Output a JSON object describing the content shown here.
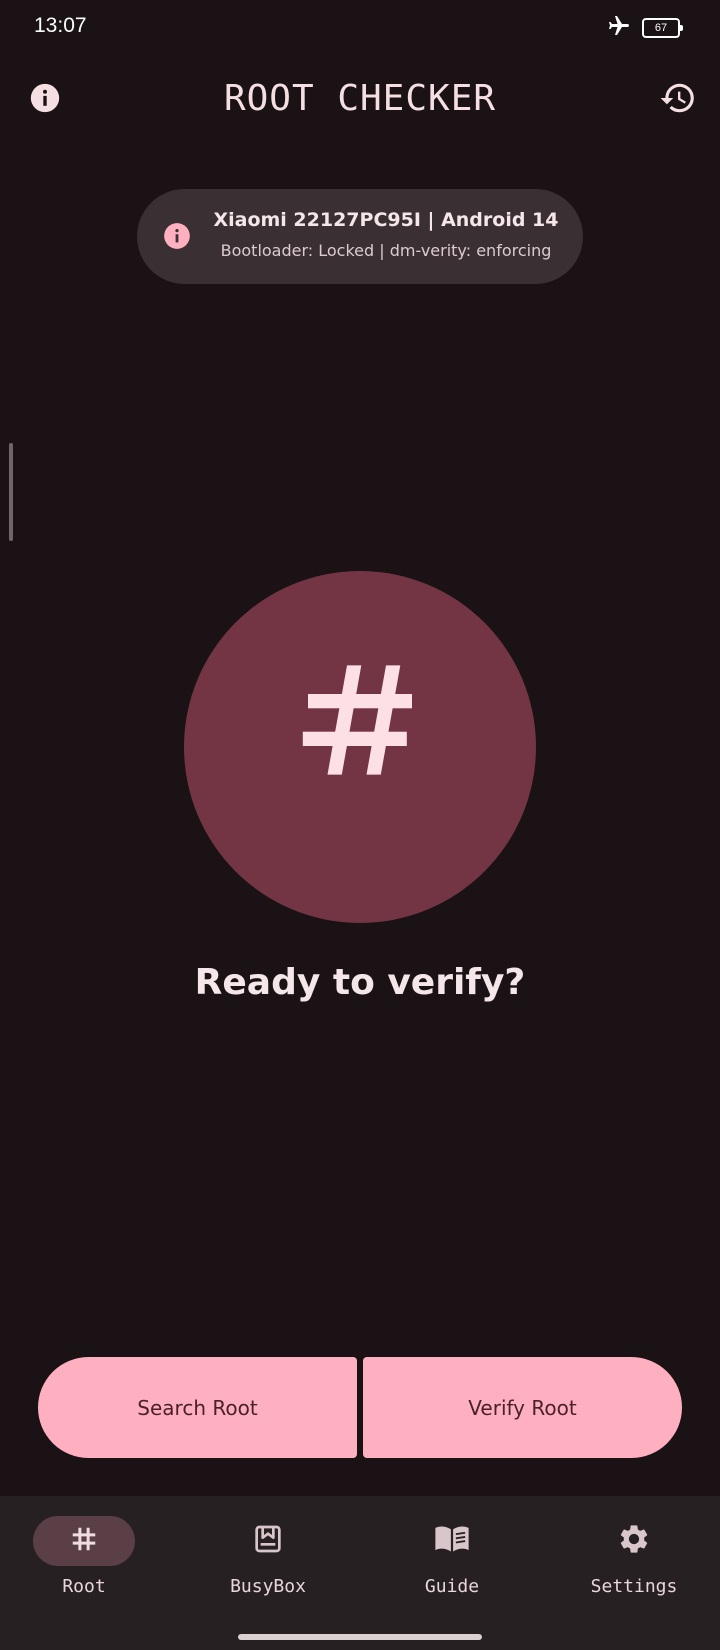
{
  "status_bar": {
    "time": "13:07",
    "battery_level": "67",
    "icons": [
      "airplane-icon",
      "battery-icon"
    ]
  },
  "app_bar": {
    "title": "ROOT CHECKER",
    "left_icon": "info-icon",
    "right_icon": "history-icon"
  },
  "device_info": {
    "model": "Xiaomi 22127PC95I | Android 14",
    "status": "Bootloader: Locked | dm-verity: enforcing",
    "icon": "info-icon"
  },
  "main": {
    "circle_icon": "hash-icon",
    "prompt": "Ready to verify?"
  },
  "actions": {
    "search_label": "Search Root",
    "verify_label": "Verify Root"
  },
  "bottom_nav": {
    "items": [
      {
        "label": "Root",
        "icon": "hash-icon",
        "active": true
      },
      {
        "label": "BusyBox",
        "icon": "busybox-icon",
        "active": false
      },
      {
        "label": "Guide",
        "icon": "book-icon",
        "active": false
      },
      {
        "label": "Settings",
        "icon": "gear-icon",
        "active": false
      }
    ]
  },
  "colors": {
    "background": "#1a1214",
    "chip": "#3a3033",
    "circle": "#733544",
    "accent": "#ffb0c0",
    "nav_background": "#272022",
    "nav_active_pill": "#5b3f46"
  }
}
